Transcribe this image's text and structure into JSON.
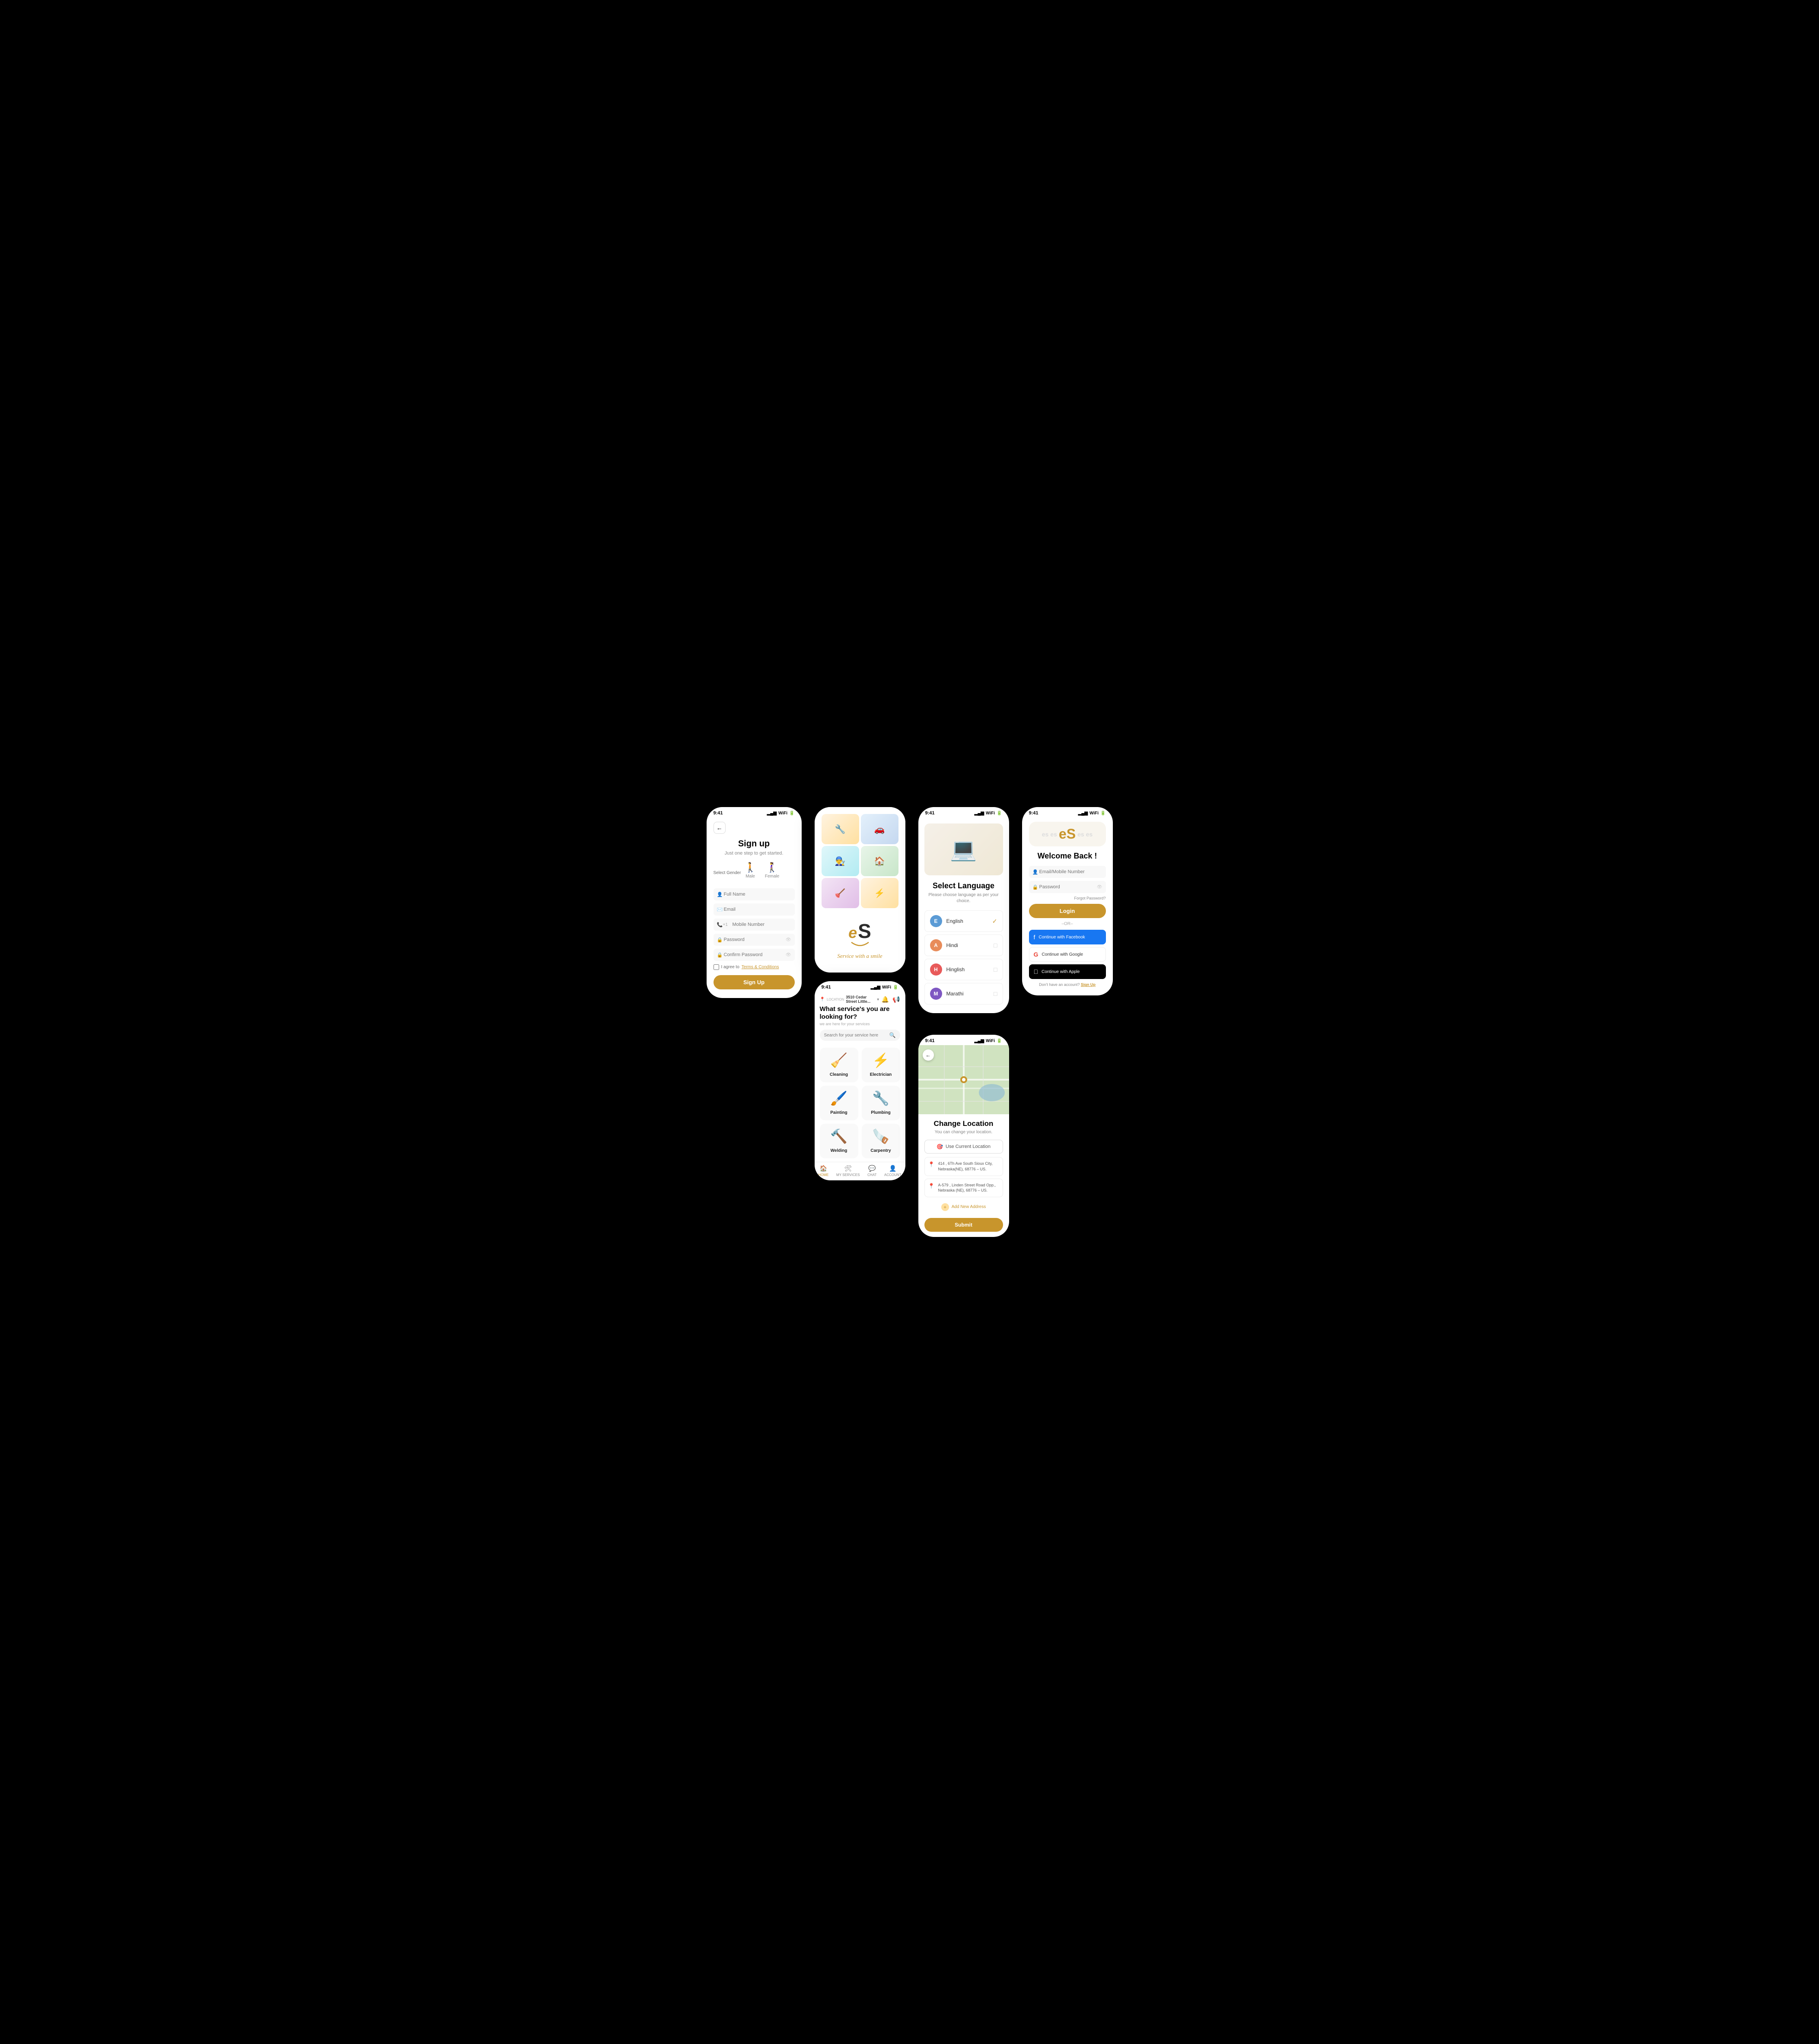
{
  "screens": {
    "signup": {
      "status_time": "9:41",
      "title": "Sign up",
      "subtitle": "Just one step to get started.",
      "gender_label": "Select Gender",
      "gender_male": "Male",
      "gender_female": "Female",
      "full_name_placeholder": "Full Name",
      "email_placeholder": "Email",
      "mobile_placeholder": "Mobile Number",
      "mobile_code": "+1",
      "password_placeholder": "Password",
      "confirm_password_placeholder": "Confirm Password",
      "terms_text": "I agree to ",
      "terms_link": "Terms & Conditions",
      "btn_signup": "Sign Up"
    },
    "splash": {
      "logo": "es",
      "tagline": "Service with a smile"
    },
    "home": {
      "status_time": "9:41",
      "location_label": "LOCATION",
      "location_text": "3510 Cedar Street Little...",
      "heading": "What service's you are looking for?",
      "subheading": "we are here for your services",
      "search_placeholder": "Search for your service here",
      "services": [
        {
          "name": "Cleaning",
          "emoji": "🧹"
        },
        {
          "name": "Electrician",
          "emoji": "⚡"
        },
        {
          "name": "Painting",
          "emoji": "🖌️"
        },
        {
          "name": "Plumbing",
          "emoji": "🔧"
        },
        {
          "name": "Welding",
          "emoji": "🔨"
        },
        {
          "name": "Carpentry",
          "emoji": "🪚"
        }
      ],
      "nav_items": [
        {
          "label": "HOME",
          "active": true
        },
        {
          "label": "MY SERVICES",
          "active": false
        },
        {
          "label": "CHAT",
          "active": false
        },
        {
          "label": "ACCOUNT",
          "active": false
        }
      ]
    },
    "language": {
      "status_time": "9:41",
      "title": "Select Language",
      "subtitle": "Please choose language as per your choice.",
      "languages": [
        {
          "code": "E",
          "name": "English",
          "color": "#5b9bd5",
          "selected": true
        },
        {
          "code": "A",
          "name": "Hindi",
          "color": "#e88c5a",
          "selected": false
        },
        {
          "code": "H",
          "name": "Hinglish",
          "color": "#e85a5a",
          "selected": false
        },
        {
          "code": "M",
          "name": "Marathi",
          "color": "#7e57c2",
          "selected": false
        }
      ]
    },
    "location": {
      "status_time": "9:41",
      "title": "Change Location",
      "subtitle": "You can change your location.",
      "use_location_btn": "Use Current Location",
      "addresses": [
        {
          "text": "414 , 6Th Ave South Sioux City, Nebraska(NE), 68776 – US."
        },
        {
          "text": "A-579 , Linden Street Road Opp., Nebraska (NE), 68776 – US."
        }
      ],
      "add_address": "Add New Address",
      "submit_btn": "Submit"
    },
    "login": {
      "status_time": "9:41",
      "welcome": "Welcome Back !",
      "email_placeholder": "Email/Mobile Number",
      "password_placeholder": "Password",
      "forgot_password": "Forgot Password?",
      "btn_login": "Login",
      "or_text": "–OR–",
      "btn_facebook": "Continue with Facebook",
      "btn_google": "Continue with Google",
      "btn_apple": "Continue with Apple",
      "no_account": "Don't have an account?",
      "signup_link": "Sign Up"
    }
  }
}
